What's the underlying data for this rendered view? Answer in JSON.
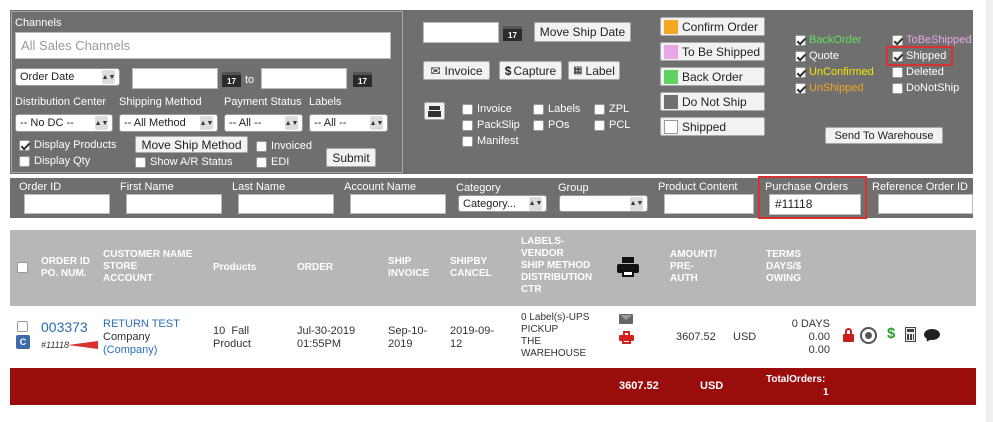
{
  "filters": {
    "channels_label": "Channels",
    "channels_placeholder": "All Sales Channels",
    "date_type": "Order Date",
    "date_to": "to",
    "cal_day": "17",
    "dc_label": "Distribution Center",
    "dc_value": "-- No DC --",
    "shipping_label": "Shipping Method",
    "shipping_value": "-- All Method",
    "payment_label": "Payment Status",
    "payment_value": "-- All --",
    "labels_label": "Labels",
    "labels_value": "-- All --",
    "display_products": "Display Products",
    "display_qty": "Display Qty",
    "move_ship_method": "Move Ship Method",
    "show_ar_status": "Show A/R Status",
    "invoiced": "Invoiced",
    "edi": "EDI",
    "submit": "Submit"
  },
  "actions": {
    "move_ship_date": "Move Ship Date",
    "invoice": "Invoice",
    "capture": "Capture",
    "label": "Label",
    "print_options": [
      "Invoice",
      "PackSlip",
      "Manifest",
      "Labels",
      "POs",
      "ZPL",
      "PCL"
    ]
  },
  "status_buttons": [
    {
      "label": "Confirm Order",
      "color": "#f5a623"
    },
    {
      "label": "To Be Shipped",
      "color": "#e9a6e6"
    },
    {
      "label": "Back Order",
      "color": "#5fd35f"
    },
    {
      "label": "Do Not Ship",
      "color": "#6f6f6f"
    },
    {
      "label": "Shipped",
      "color": "#ffffff"
    }
  ],
  "legend": {
    "left": [
      {
        "label": "BackOrder",
        "color": "#63e05b"
      },
      {
        "label": "Quote",
        "color": "#ffffff"
      },
      {
        "label": "UnConfirmed",
        "color": "#f4e600"
      },
      {
        "label": "UnShipped",
        "color": "#f5a623"
      }
    ],
    "right": [
      {
        "label": "ToBeShipped",
        "color": "#e9a6e6"
      },
      {
        "label": "Shipped",
        "color": "#ffffff"
      },
      {
        "label": "Deleted",
        "color": "#ffffff"
      },
      {
        "label": "DoNotShip",
        "color": "#ffffff"
      }
    ],
    "send_to_warehouse": "Send To Warehouse"
  },
  "search": {
    "order_id": "Order ID",
    "first_name": "First Name",
    "last_name": "Last Name",
    "account_name": "Account Name",
    "category": "Category",
    "category_value": "Category...",
    "group": "Group",
    "product_content": "Product Content",
    "purchase_orders": "Purchase Orders",
    "purchase_orders_value": "#11118",
    "reference_order_id": "Reference Order ID"
  },
  "table": {
    "headers": {
      "order_id": [
        "ORDER ID",
        "PO. NUM."
      ],
      "customer": [
        "CUSTOMER NAME",
        "STORE",
        "ACCOUNT"
      ],
      "products": [
        "Products"
      ],
      "order": [
        "ORDER"
      ],
      "ship": [
        "SHIP",
        "INVOICE"
      ],
      "shipby": [
        "SHIPBY",
        "CANCEL"
      ],
      "labels": [
        "LABELS-",
        "VENDOR",
        "SHIP METHOD",
        "DISTRIBUTION",
        "CTR"
      ],
      "amount": [
        "AMOUNT/",
        "PRE-",
        "AUTH"
      ],
      "terms": [
        "TERMS",
        "DAYS/$",
        "OWING"
      ]
    },
    "row": {
      "order_id": "003373",
      "badge": "C",
      "po_num": "#11118",
      "customer_name": "RETURN TEST",
      "store": "Company",
      "account": "(Company)",
      "products": [
        "10  Fall",
        "Product"
      ],
      "order": [
        "Jul-30-2019",
        "01:55PM"
      ],
      "ship": [
        "Sep-10-",
        "2019"
      ],
      "shipby": [
        "2019-09-",
        "12"
      ],
      "labels": [
        "0 Label(s)-UPS",
        "PICKUP",
        "THE",
        "WAREHOUSE"
      ],
      "amount": "3607.52",
      "currency": "USD",
      "terms": [
        "0 DAYS",
        "0.00",
        "0.00"
      ]
    },
    "footer": {
      "amount": "3607.52",
      "currency": "USD",
      "total_label": "TotalOrders:",
      "total_value": "1"
    }
  }
}
